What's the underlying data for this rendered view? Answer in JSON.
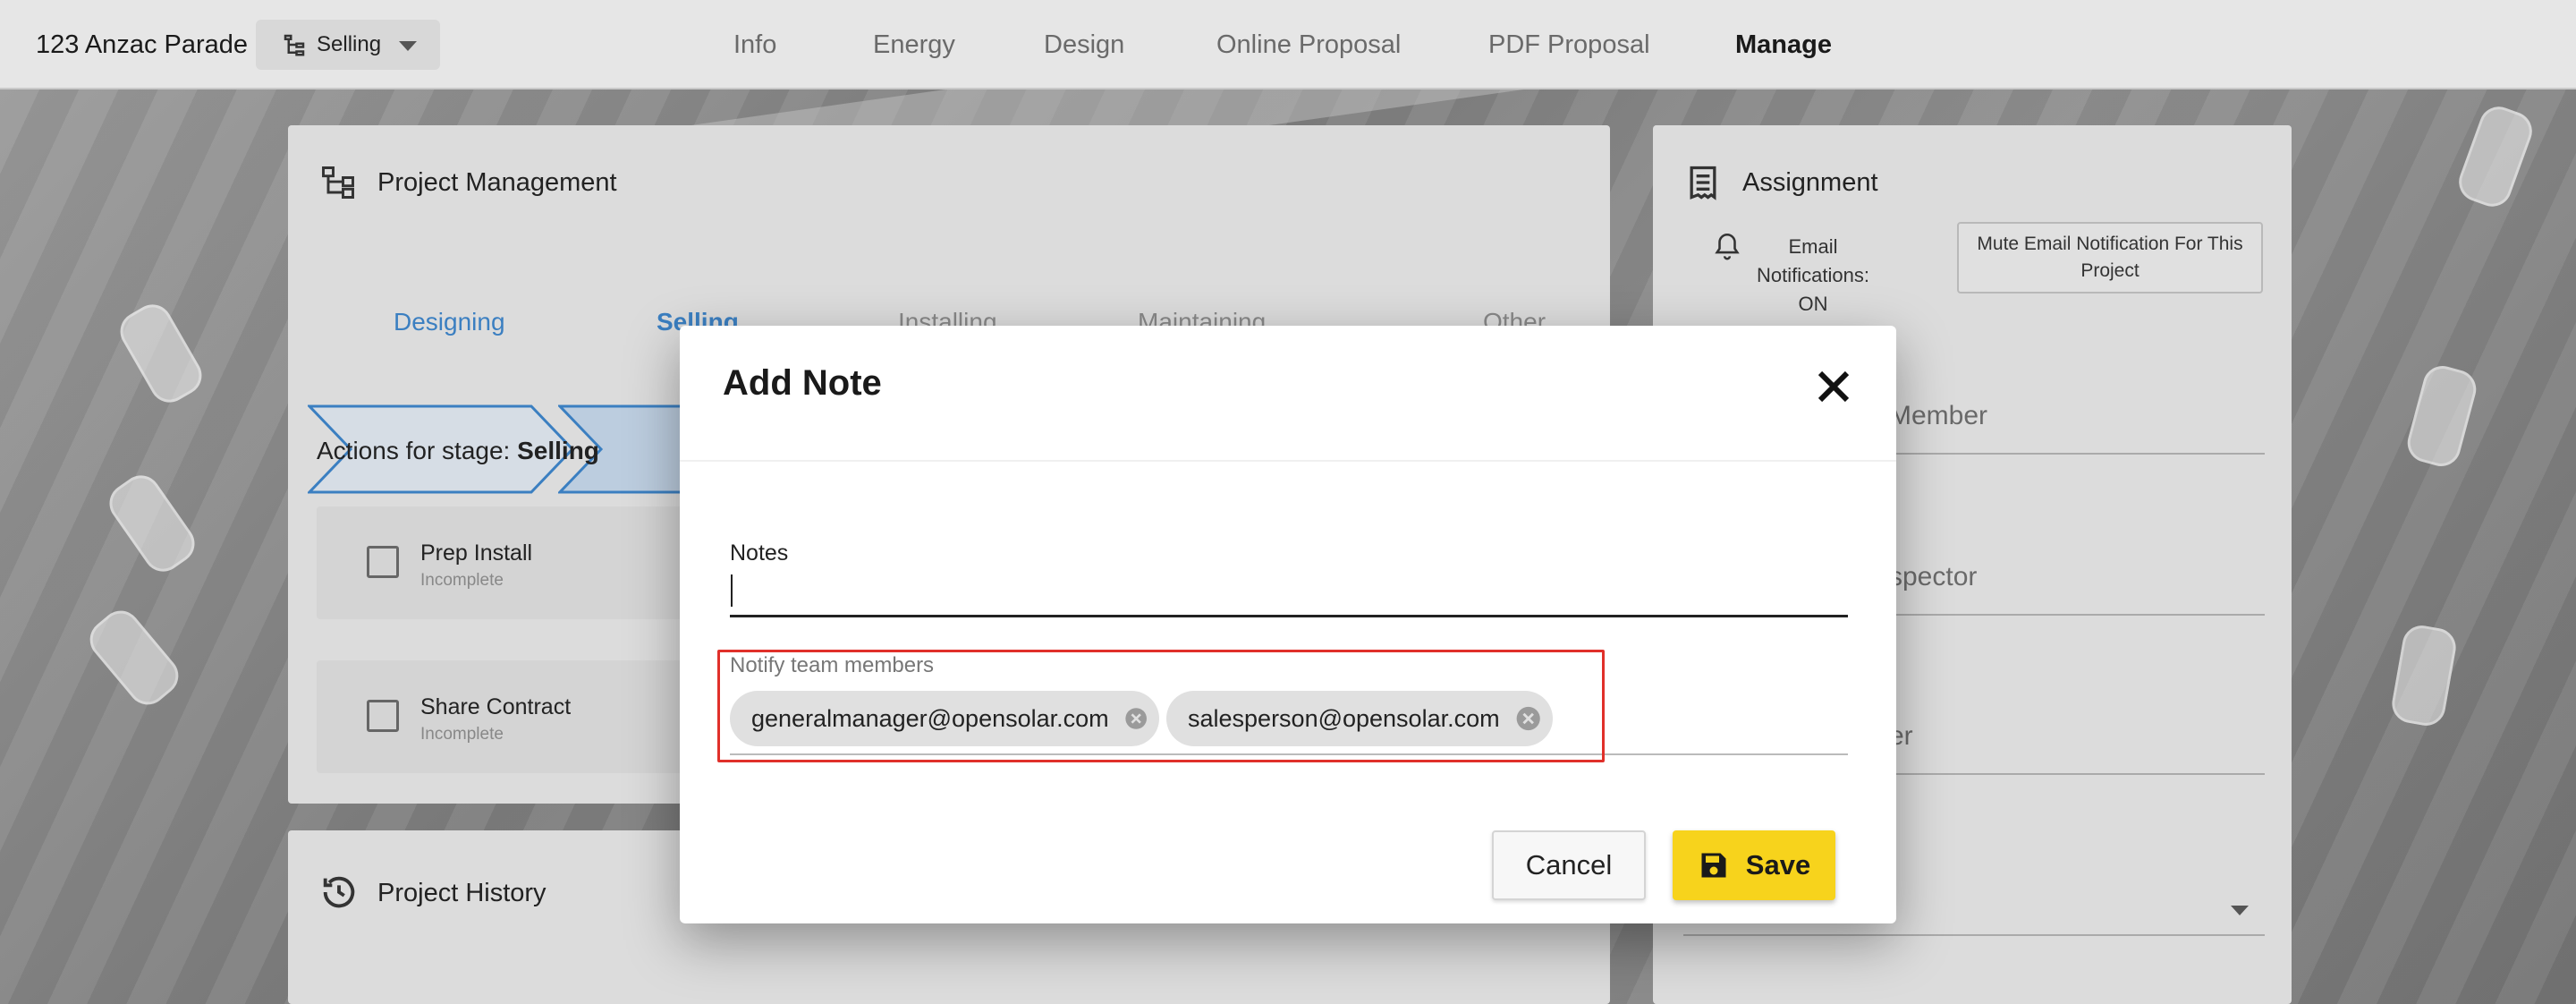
{
  "header": {
    "project_title": "123 Anzac Parade",
    "stage_select": "Selling",
    "tabs": [
      "Info",
      "Energy",
      "Design",
      "Online Proposal",
      "PDF Proposal",
      "Manage"
    ],
    "active_tab": "Manage"
  },
  "project_management": {
    "title": "Project Management",
    "stages": [
      "Designing",
      "Selling",
      "Installing",
      "Maintaining",
      "Other"
    ],
    "actions_prefix": "Actions for stage: ",
    "actions_stage": "Selling",
    "tasks": [
      {
        "name": "Prep Install",
        "status": "Incomplete"
      },
      {
        "name": "Share Contract",
        "status": "Incomplete"
      }
    ]
  },
  "project_history": {
    "title": "Project History"
  },
  "assignment": {
    "title": "Assignment",
    "email_notifications": "Email Notifications: ON",
    "mute_button": "Mute Email Notification For This Project",
    "fields": [
      "Member",
      "spector",
      "er"
    ]
  },
  "dialog": {
    "title": "Add Note",
    "notes_label": "Notes",
    "notes_value": "",
    "notify_label": "Notify team members",
    "chips": [
      "generalmanager@opensolar.com",
      "salesperson@opensolar.com"
    ],
    "cancel_label": "Cancel",
    "save_label": "Save"
  },
  "colors": {
    "accent_yellow": "#f7d31c",
    "highlight_red": "#e0302a",
    "stage_blue": "#3b7fc1"
  }
}
